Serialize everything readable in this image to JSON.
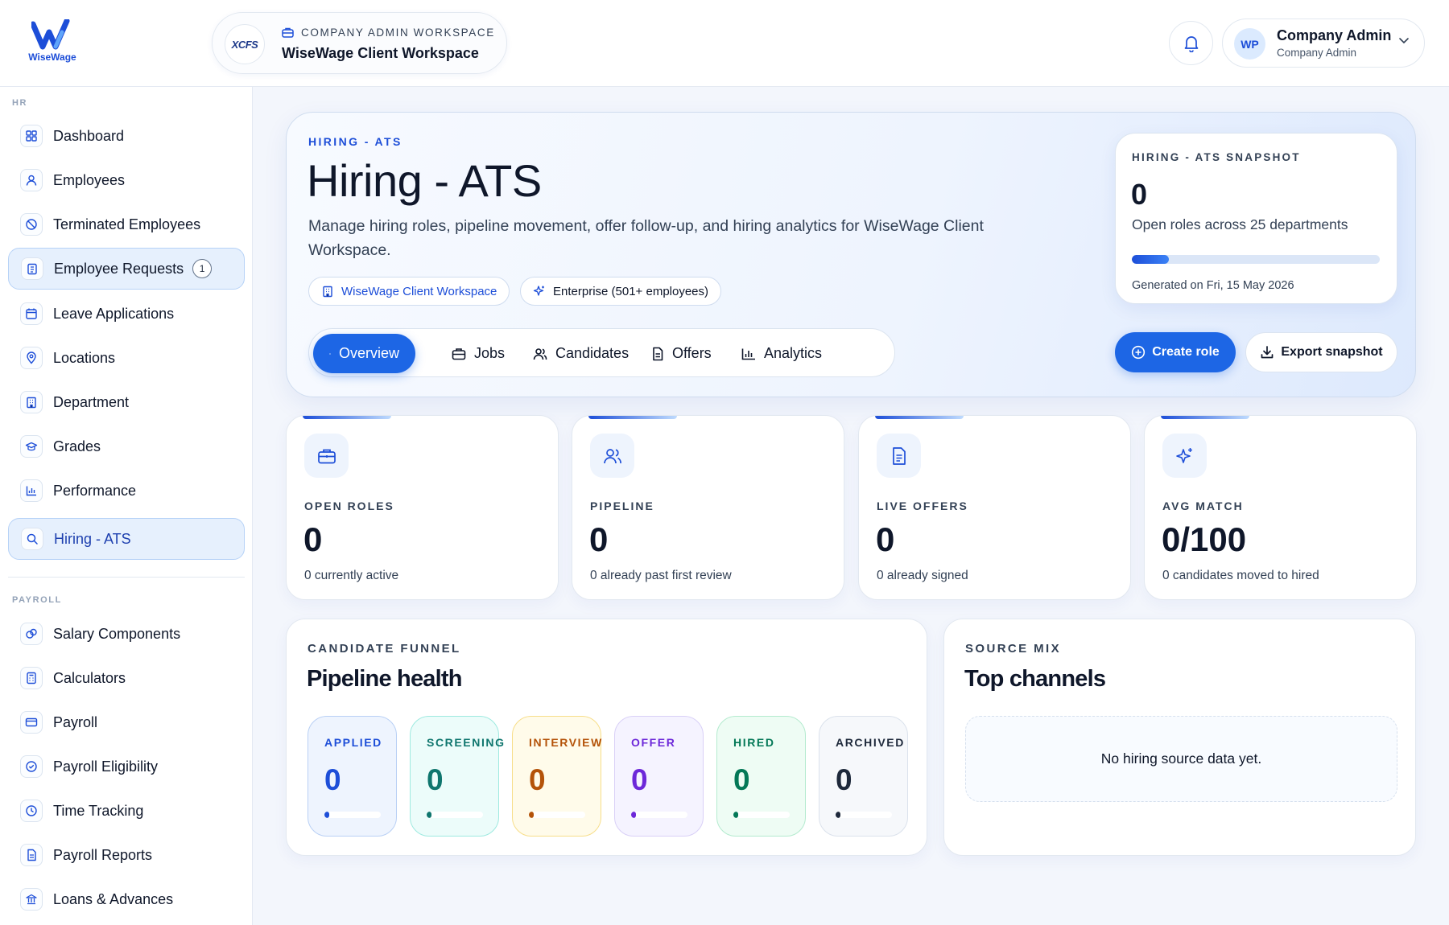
{
  "brand": {
    "logo_text": "WiseWage"
  },
  "workspace": {
    "logo_text": "XCFS",
    "kicker": "COMPANY ADMIN WORKSPACE",
    "name": "WiseWage Client Workspace"
  },
  "user": {
    "initials": "WP",
    "name": "Company Admin",
    "role": "Company Admin"
  },
  "sidebar": {
    "hr_label": "HR",
    "hr_items": [
      {
        "label": "Dashboard",
        "icon": "grid-icon"
      },
      {
        "label": "Employees",
        "icon": "user-icon"
      },
      {
        "label": "Terminated Employees",
        "icon": "user-off-icon"
      },
      {
        "label": "Employee Requests",
        "icon": "clipboard-icon",
        "badge": "1",
        "active": true
      },
      {
        "label": "Leave Applications",
        "icon": "calendar-icon"
      },
      {
        "label": "Locations",
        "icon": "map-pin-icon"
      },
      {
        "label": "Department",
        "icon": "building-icon"
      },
      {
        "label": "Grades",
        "icon": "graduation-cap-icon"
      },
      {
        "label": "Performance",
        "icon": "bar-chart-icon"
      },
      {
        "label": "Hiring - ATS",
        "icon": "search-icon",
        "active": true
      }
    ],
    "payroll_label": "PAYROLL",
    "payroll_items": [
      {
        "label": "Salary Components",
        "icon": "coins-icon"
      },
      {
        "label": "Calculators",
        "icon": "calculator-icon"
      },
      {
        "label": "Payroll",
        "icon": "card-icon"
      },
      {
        "label": "Payroll Eligibility",
        "icon": "check-circle-icon"
      },
      {
        "label": "Time Tracking",
        "icon": "clock-icon"
      },
      {
        "label": "Payroll Reports",
        "icon": "file-icon"
      },
      {
        "label": "Loans & Advances",
        "icon": "bank-icon"
      }
    ]
  },
  "hero": {
    "kicker": "HIRING - ATS",
    "title": "Hiring - ATS",
    "description": "Manage hiring roles, pipeline movement, offer follow-up, and hiring analytics for WiseWage Client Workspace.",
    "pill_workspace": "WiseWage Client Workspace",
    "pill_size": "Enterprise (501+ employees)",
    "tabs": [
      "Overview",
      "Jobs",
      "Candidates",
      "Offers",
      "Analytics"
    ],
    "active_tab": "Overview",
    "create_label": "Create role",
    "export_label": "Export snapshot"
  },
  "snapshot": {
    "kicker": "HIRING - ATS SNAPSHOT",
    "value": "0",
    "description": "Open roles across 25 departments",
    "progress_fraction": 0.15,
    "generated": "Generated on Fri, 15 May 2026"
  },
  "metrics": [
    {
      "label": "OPEN ROLES",
      "value": "0",
      "desc": "0 currently active",
      "icon": "briefcase-icon"
    },
    {
      "label": "PIPELINE",
      "value": "0",
      "desc": "0 already past first review",
      "icon": "users-icon"
    },
    {
      "label": "LIVE OFFERS",
      "value": "0",
      "desc": "0 already signed",
      "icon": "document-icon"
    },
    {
      "label": "AVG MATCH",
      "value": "0/100",
      "desc": "0 candidates moved to hired",
      "icon": "sparkles-icon"
    }
  ],
  "funnel": {
    "kicker": "CANDIDATE FUNNEL",
    "title": "Pipeline health",
    "stages": [
      {
        "label": "APPLIED",
        "value": "0",
        "color": "#1d4ed8",
        "bg": "#eef4fe",
        "border": "#b9d0f5"
      },
      {
        "label": "SCREENING",
        "value": "0",
        "color": "#0f766e",
        "bg": "#ecfcfa",
        "border": "#9eeae0"
      },
      {
        "label": "INTERVIEW",
        "value": "0",
        "color": "#b45309",
        "bg": "#fffbea",
        "border": "#f7de8a"
      },
      {
        "label": "OFFER",
        "value": "0",
        "color": "#6d28d9",
        "bg": "#f5f3ff",
        "border": "#d9d0f7"
      },
      {
        "label": "HIRED",
        "value": "0",
        "color": "#047857",
        "bg": "#eefcf4",
        "border": "#b4ebcf"
      },
      {
        "label": "ARCHIVED",
        "value": "0",
        "color": "#1e293b",
        "bg": "#f6f8fb",
        "border": "#dbe2ec"
      }
    ]
  },
  "source": {
    "kicker": "SOURCE MIX",
    "title": "Top channels",
    "empty_text": "No hiring source data yet."
  }
}
